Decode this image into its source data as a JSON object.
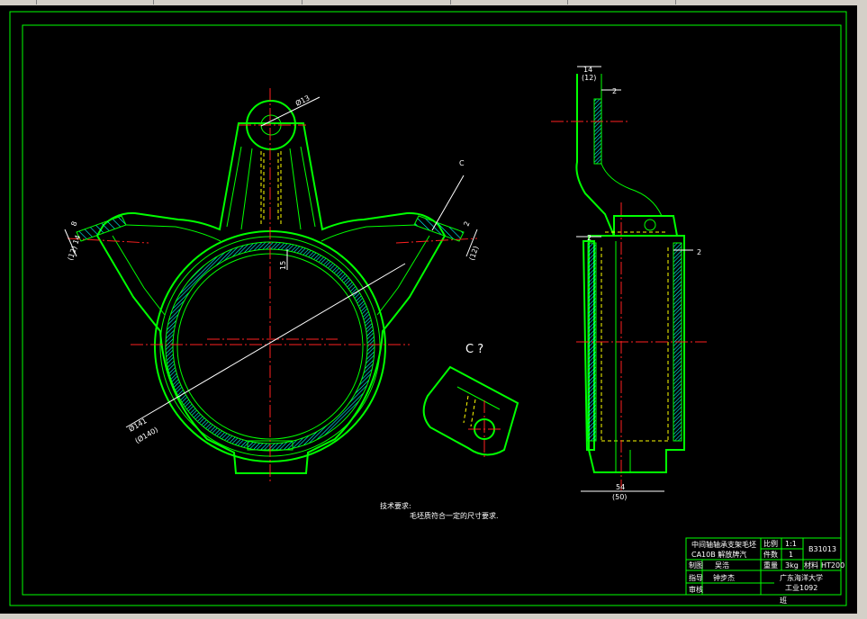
{
  "drawing": {
    "dims": {
      "hole_dia": "Ø13",
      "bore_dia_a": "Ø141",
      "bore_dia_b": "(Ø140)",
      "wall_15": "15",
      "ear_8": "8",
      "ear_14": "14",
      "ear_12": "(12)",
      "ear_2": "2",
      "top_14": "14",
      "top_12": "(12)",
      "side_2a": "2",
      "side_2b": "2",
      "side_2c": "2",
      "width_54": "54",
      "width_50": "(50)"
    },
    "view_c_label": "C",
    "view_c_title": "C ?",
    "notes_title": "技术要求:",
    "notes_body": "毛坯质符合一定的尺寸要求."
  },
  "title_block": {
    "part_name_1": "中间轴轴承支架毛坯",
    "part_name_2": "CA10B  解放牌汽",
    "scale_label": "比例",
    "scale_value": "1:1",
    "qty_label": "件数",
    "qty_value": "1",
    "drawing_no": "B31013",
    "drawn_label": "制图",
    "drawn_name": "吴浩",
    "weight_label": "重量",
    "weight_value": "3kg",
    "material_label": "材料",
    "material_value": "HT200",
    "guide_label": "指导",
    "guide_name": "钟步杰",
    "school": "广东海洋大学",
    "class": "工业1092",
    "review_label": "审核",
    "extra": "班"
  }
}
